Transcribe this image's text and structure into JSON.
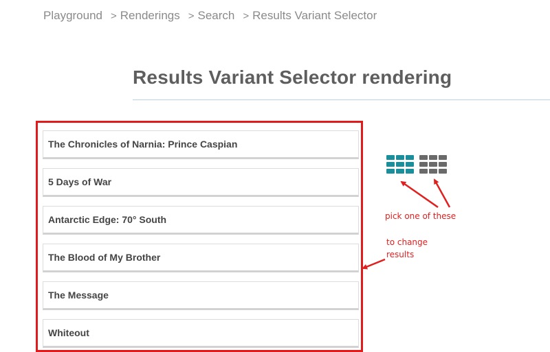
{
  "breadcrumb": {
    "items": [
      "Playground",
      "Renderings",
      "Search",
      "Results Variant Selector"
    ],
    "separator": ">"
  },
  "page": {
    "title": "Results Variant Selector rendering"
  },
  "results": [
    {
      "title": "The Chronicles of Narnia: Prince Caspian"
    },
    {
      "title": "5 Days of War"
    },
    {
      "title": "Antarctic Edge: 70° South"
    },
    {
      "title": "The Blood of My Brother"
    },
    {
      "title": "The Message"
    },
    {
      "title": "Whiteout"
    }
  ],
  "variant_selector": {
    "options": [
      {
        "icon": "grid-icon",
        "color": "#1b8e9b",
        "active": true
      },
      {
        "icon": "grid-icon",
        "color": "#6a6a6a",
        "active": false
      }
    ]
  },
  "annotations": {
    "pick": "pick one of these",
    "change_line1": "to change",
    "change_line2": "results",
    "color": "#e02020"
  }
}
